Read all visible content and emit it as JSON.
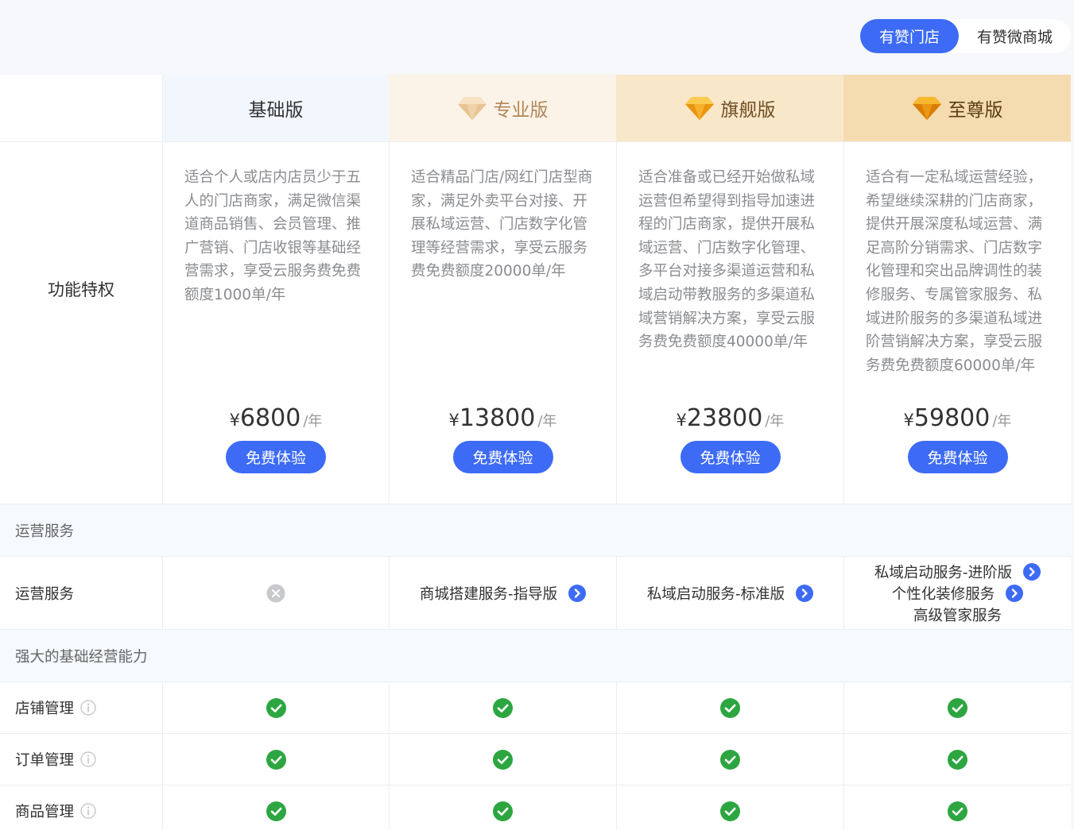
{
  "tabs": [
    {
      "label": "有赞门店",
      "active": true
    },
    {
      "label": "有赞微商城",
      "active": false
    }
  ],
  "plans": [
    {
      "name": "基础版",
      "desc": "适合个人或店内店员少于五人的门店商家，满足微信渠道商品销售、会员管理、推广营销、门店收银等基础经营需求，享受云服务费免费额度1000单/年",
      "currency": "¥",
      "price": "6800",
      "unit": "/年",
      "cta": "免费体验",
      "icon": "none"
    },
    {
      "name": "专业版",
      "desc": "适合精品门店/网红门店型商家，满足外卖平台对接、开展私域运营、门店数字化管理等经营需求，享受云服务费免费额度20000单/年",
      "currency": "¥",
      "price": "13800",
      "unit": "/年",
      "cta": "免费体验",
      "icon": "diamond-icon"
    },
    {
      "name": "旗舰版",
      "desc": "适合准备或已经开始做私域运营但希望得到指导加速进程的门店商家，提供开展私域运营、门店数字化管理、多平台对接多渠道运营和私域启动带教服务的多渠道私域营销解决方案，享受云服务费免费额度40000单/年",
      "currency": "¥",
      "price": "23800",
      "unit": "/年",
      "cta": "免费体验",
      "icon": "diamond-icon"
    },
    {
      "name": "至尊版",
      "desc": "适合有一定私域运营经验，希望继续深耕的门店商家，提供开展深度私域运营、满足高阶分销需求、门店数字化管理和突出品牌调性的装修服务、专属管家服务、私域进阶服务的多渠道私域进阶营销解决方案，享受云服务费免费额度60000单/年",
      "currency": "¥",
      "price": "59800",
      "unit": "/年",
      "cta": "免费体验",
      "icon": "diamond-icon"
    }
  ],
  "table": {
    "feature_header": "功能特权",
    "sections": [
      {
        "title": "运营服务",
        "rows": [
          {
            "label": "运营服务",
            "cells": [
              {
                "type": "cross",
                "icon": "cross-circle-icon"
              },
              {
                "type": "services",
                "items": [
                  {
                    "text": "商城搭建服务-指导版",
                    "link": true
                  }
                ]
              },
              {
                "type": "services",
                "items": [
                  {
                    "text": "私域启动服务-标准版",
                    "link": true
                  }
                ]
              },
              {
                "type": "services",
                "items": [
                  {
                    "text": "私域启动服务-进阶版",
                    "link": true
                  },
                  {
                    "text": "个性化装修服务",
                    "link": true
                  },
                  {
                    "text": "高级管家服务",
                    "link": false
                  }
                ]
              }
            ]
          }
        ]
      },
      {
        "title": "强大的基础经营能力",
        "rows": [
          {
            "label": "店铺管理",
            "info": true,
            "cells": [
              "check",
              "check",
              "check",
              "check"
            ]
          },
          {
            "label": "订单管理",
            "info": true,
            "cells": [
              "check",
              "check",
              "check",
              "check"
            ]
          },
          {
            "label": "商品管理",
            "info": true,
            "cells": [
              "check",
              "check",
              "check",
              "check"
            ]
          }
        ]
      }
    ]
  },
  "colors": {
    "primary": "#3d6bf5",
    "check": "#2da641",
    "header_basic": "#f2f7fd",
    "header_pro": "#fcf3e8",
    "header_flagship": "#f9e7c9",
    "header_supreme": "#f5dcb0",
    "desc_text": "#8a8c90"
  }
}
